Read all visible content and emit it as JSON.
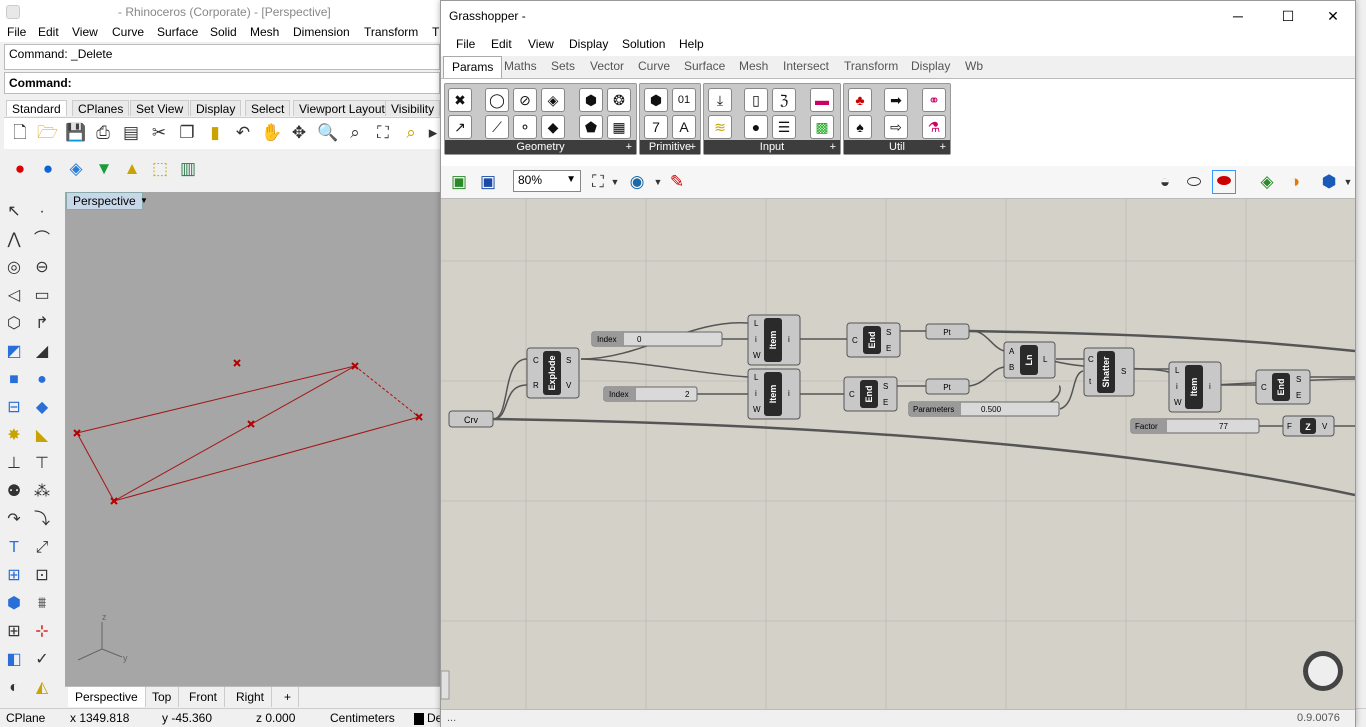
{
  "rhino": {
    "title": "- Rhinoceros (Corporate) - [Perspective]",
    "menu": [
      "File",
      "Edit",
      "View",
      "Curve",
      "Surface",
      "Solid",
      "Mesh",
      "Dimension",
      "Transform",
      "T"
    ],
    "command_history": "Command: _Delete",
    "command_prompt": "Command:",
    "toolbar_tabs": [
      "Standard",
      "CPlanes",
      "Set View",
      "Display",
      "Select",
      "Viewport Layout",
      "Visibility"
    ],
    "viewport_label": "Perspective",
    "viewport_tabs": [
      "Perspective",
      "Top",
      "Front",
      "Right",
      "+"
    ],
    "axis_labels": {
      "z": "z",
      "y": "y"
    },
    "status": {
      "cplane": "CPlane",
      "x": "x 1349.818",
      "y": "y -45.360",
      "z": "z 0.000",
      "units": "Centimeters",
      "layer": "De"
    }
  },
  "grasshopper": {
    "title": "Grasshopper -",
    "menu": [
      "File",
      "Edit",
      "View",
      "Display",
      "Solution",
      "Help"
    ],
    "tabs": [
      "Params",
      "Maths",
      "Sets",
      "Vector",
      "Curve",
      "Surface",
      "Mesh",
      "Intersect",
      "Transform",
      "Display",
      "Wb"
    ],
    "panels": [
      "Geometry",
      "Primitive",
      "Input",
      "Util"
    ],
    "zoom": "80%",
    "version": "0.9.0076",
    "status_left": "...",
    "components": {
      "crv": "Crv",
      "explode": "Explode",
      "explode_in": [
        "C",
        "R"
      ],
      "explode_out": [
        "S",
        "V"
      ],
      "item": "Item",
      "item_in": [
        "L",
        "i",
        "W"
      ],
      "item_out": "i",
      "end": "End",
      "end_in": "C",
      "end_out": [
        "S",
        "E"
      ],
      "pt": "Pt",
      "ln": "Ln",
      "ln_in": [
        "A",
        "B"
      ],
      "ln_out": "L",
      "shatter": "Shatter",
      "shatter_in": [
        "C",
        "t"
      ],
      "shatter_out": "S",
      "z": "Z",
      "z_in": "F",
      "z_out": "V"
    },
    "sliders": {
      "index1": {
        "label": "Index",
        "value": "0"
      },
      "index2": {
        "label": "Index",
        "value": "2"
      },
      "parameters": {
        "label": "Parameters",
        "value": "0.500"
      },
      "factor": {
        "label": "Factor",
        "value": "77"
      }
    }
  }
}
